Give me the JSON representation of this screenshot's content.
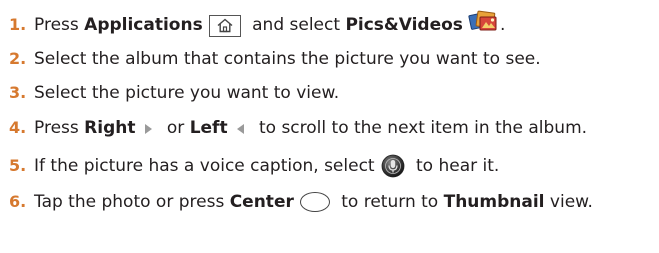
{
  "steps": [
    {
      "number": "1.",
      "t1": "Press ",
      "b1": "Applications",
      "t2": " and select ",
      "b2": "Pics&Videos",
      "t3": "."
    },
    {
      "number": "2.",
      "t1": "Select the album that contains the picture you want to see."
    },
    {
      "number": "3.",
      "t1": "Select the picture you want to view."
    },
    {
      "number": "4.",
      "t1": "Press ",
      "b1": "Right",
      "t2": " or ",
      "b2": "Left",
      "t3": " to scroll to the next item in the album."
    },
    {
      "number": "5.",
      "t1": "If the picture has a voice caption, select",
      "t2": " to hear it."
    },
    {
      "number": "6.",
      "t1": "Tap the photo or press ",
      "b1": "Center",
      "t2": " to return to ",
      "b2": "Thumbnail",
      "t3": " view."
    }
  ],
  "colors": {
    "step_number": "#d6792f",
    "text": "#231f20"
  },
  "icons": {
    "applications_key": "home-key-icon",
    "pics_videos_app": "pics-videos-app-icon",
    "right_key": "right-arrow-icon",
    "left_key": "left-arrow-icon",
    "voice_caption": "voice-caption-icon",
    "center_key": "center-key-icon"
  }
}
